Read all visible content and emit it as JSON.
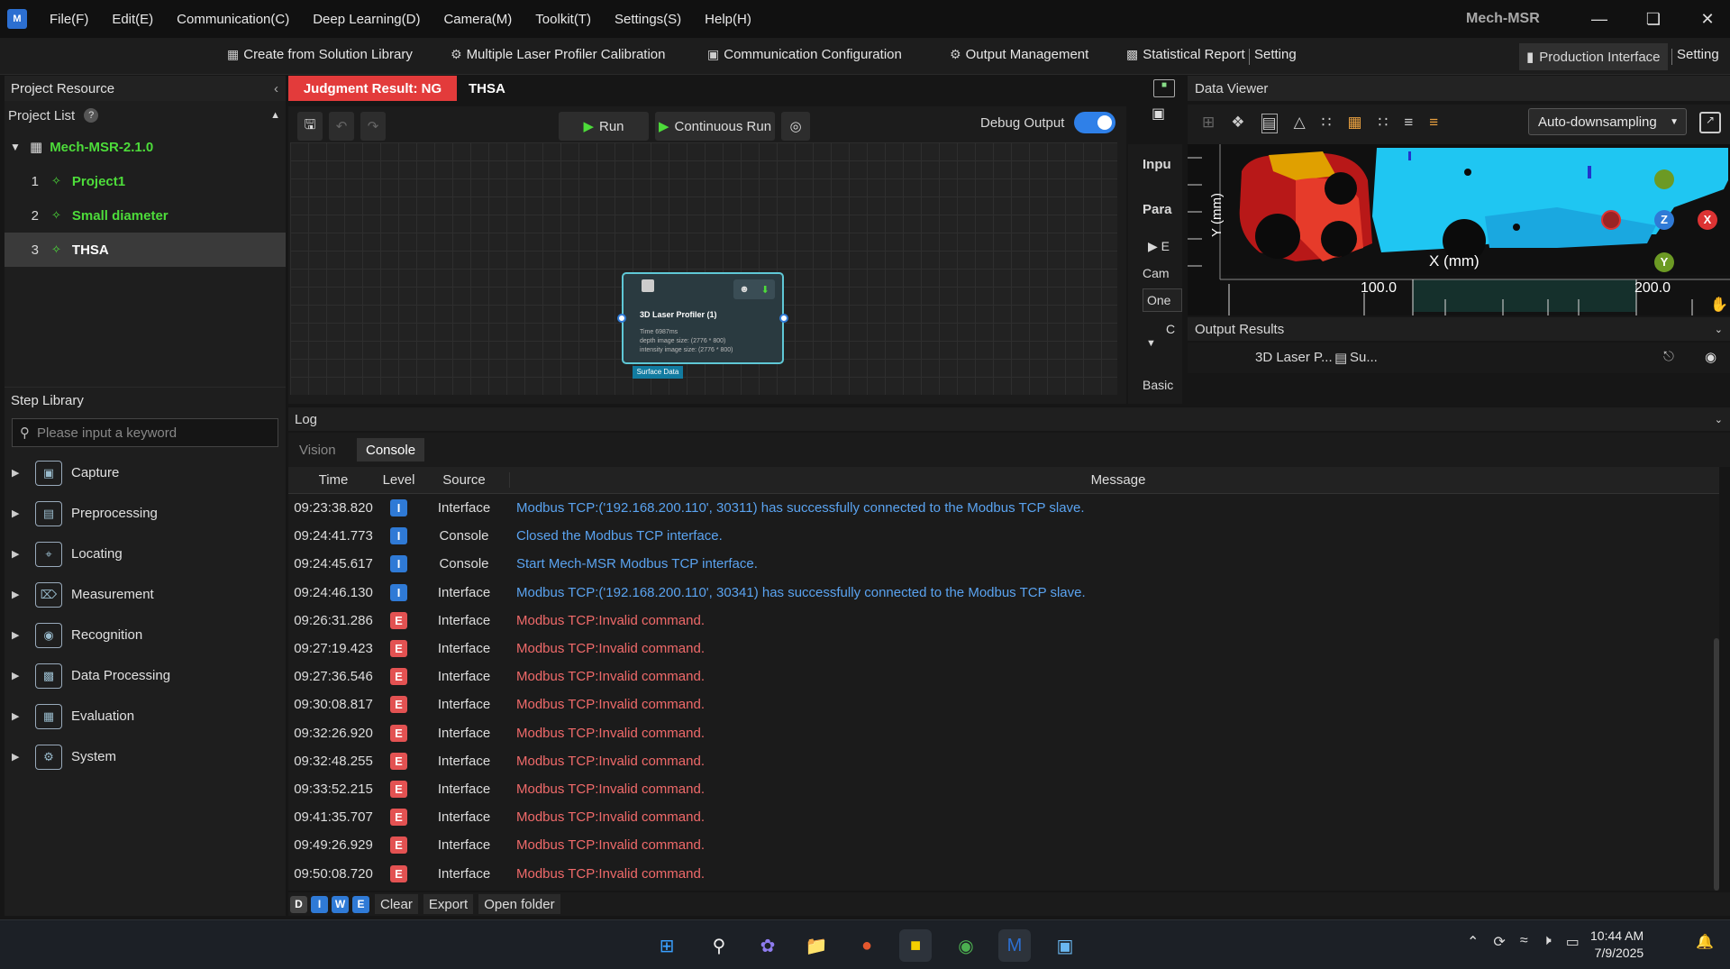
{
  "menubar": {
    "items": [
      "File(F)",
      "Edit(E)",
      "Communication(C)",
      "Deep Learning(D)",
      "Camera(M)",
      "Toolkit(T)",
      "Settings(S)",
      "Help(H)"
    ],
    "app_title": "Mech-MSR"
  },
  "toolbar": {
    "create_solution": "Create from Solution Library",
    "multi_laser": "Multiple Laser Profiler Calibration",
    "comm_config": "Communication Configuration",
    "output_mgmt": "Output Management",
    "stat_report": "Statistical Report",
    "setting1": "Setting",
    "production": "Production Interface",
    "setting2": "Setting"
  },
  "project_resource": {
    "title": "Project Resource",
    "list_label": "Project List",
    "root": "Mech-MSR-2.1.0",
    "projects": [
      {
        "num": "1",
        "name": "Project1"
      },
      {
        "num": "2",
        "name": "Small diameter"
      },
      {
        "num": "3",
        "name": "THSA"
      }
    ]
  },
  "step_library": {
    "title": "Step Library",
    "search_placeholder": "Please input a keyword",
    "categories": [
      "Capture",
      "Preprocessing",
      "Locating",
      "Measurement",
      "Recognition",
      "Data Processing",
      "Evaluation",
      "System"
    ]
  },
  "graph": {
    "judgment": "Judgment Result: NG",
    "flow_name": "THSA",
    "run": "Run",
    "continuous_run": "Continuous Run",
    "debug_output": "Debug Output",
    "node_title": "3D Laser Profiler (1)",
    "node_line1": "Time 6987ms",
    "node_line2": "depth image size: (2776 * 800)",
    "node_line3": "intensity image size: (2776 * 800)",
    "node_port": "Surface Data"
  },
  "input_panel": {
    "input": "Inpu",
    "param": "Para",
    "e": "E",
    "cam": "Cam",
    "one": "One",
    "c": "C",
    "basic": "Basic"
  },
  "data_viewer": {
    "title": "Data Viewer",
    "downsampling": "Auto-downsampling",
    "y_axis_label": "Y (mm)",
    "x_axis_label": "X (mm)",
    "tick_100": "100.0",
    "tick_200": "200.0",
    "axis_z": "Z",
    "axis_x": "X",
    "axis_y": "Y"
  },
  "output_results": {
    "title": "Output Results",
    "col1": "3D Laser P...",
    "col2": "Su..."
  },
  "log": {
    "title": "Log",
    "tab_vision": "Vision",
    "tab_console": "Console",
    "headers": {
      "time": "Time",
      "level": "Level",
      "source": "Source",
      "message": "Message"
    },
    "rows": [
      {
        "time": "09:23:38.820",
        "level": "I",
        "source": "Interface",
        "message": "Modbus TCP:('192.168.200.110', 30311) has successfully connected to the Modbus TCP slave."
      },
      {
        "time": "09:24:41.773",
        "level": "I",
        "source": "Console",
        "message": "Closed the Modbus TCP interface."
      },
      {
        "time": "09:24:45.617",
        "level": "I",
        "source": "Console",
        "message": "Start Mech-MSR Modbus TCP interface."
      },
      {
        "time": "09:24:46.130",
        "level": "I",
        "source": "Interface",
        "message": "Modbus TCP:('192.168.200.110', 30341) has successfully connected to the Modbus TCP slave."
      },
      {
        "time": "09:26:31.286",
        "level": "E",
        "source": "Interface",
        "message": "Modbus TCP:Invalid command."
      },
      {
        "time": "09:27:19.423",
        "level": "E",
        "source": "Interface",
        "message": "Modbus TCP:Invalid command."
      },
      {
        "time": "09:27:36.546",
        "level": "E",
        "source": "Interface",
        "message": "Modbus TCP:Invalid command."
      },
      {
        "time": "09:30:08.817",
        "level": "E",
        "source": "Interface",
        "message": "Modbus TCP:Invalid command."
      },
      {
        "time": "09:32:26.920",
        "level": "E",
        "source": "Interface",
        "message": "Modbus TCP:Invalid command."
      },
      {
        "time": "09:32:48.255",
        "level": "E",
        "source": "Interface",
        "message": "Modbus TCP:Invalid command."
      },
      {
        "time": "09:33:52.215",
        "level": "E",
        "source": "Interface",
        "message": "Modbus TCP:Invalid command."
      },
      {
        "time": "09:41:35.707",
        "level": "E",
        "source": "Interface",
        "message": "Modbus TCP:Invalid command."
      },
      {
        "time": "09:49:26.929",
        "level": "E",
        "source": "Interface",
        "message": "Modbus TCP:Invalid command."
      },
      {
        "time": "09:50:08.720",
        "level": "E",
        "source": "Interface",
        "message": "Modbus TCP:Invalid command."
      }
    ],
    "filters": [
      "D",
      "I",
      "W",
      "E"
    ],
    "clear": "Clear",
    "export": "Export",
    "open_folder": "Open folder"
  },
  "taskbar": {
    "time": "10:44 AM",
    "date": "7/9/2025"
  },
  "colors": {
    "info": "#2f7ad6",
    "error": "#e35252",
    "info_text": "#5aa3f0",
    "error_text": "#f06a6a",
    "green": "#4ddc3a",
    "judgment_ng": "#e33b3b"
  }
}
